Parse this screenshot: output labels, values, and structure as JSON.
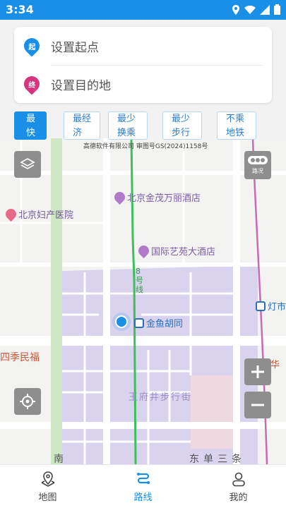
{
  "status_bar": {
    "time": "3:34"
  },
  "search": {
    "start_placeholder": "设置起点",
    "start_badge": "起",
    "end_placeholder": "设置目的地",
    "end_badge": "终"
  },
  "route_tabs": [
    {
      "label": "最快捷",
      "active": true
    },
    {
      "label": "最经济",
      "active": false
    },
    {
      "label": "最少换乘",
      "active": false
    },
    {
      "label": "最少步行",
      "active": false
    },
    {
      "label": "不乘地铁",
      "active": false
    }
  ],
  "map": {
    "copyright": "高德软件有限公司 审图号GS(2024)1158号",
    "traffic_label": "路况",
    "line_label": "8号线",
    "pois": [
      {
        "name": "北京金茂万丽酒店"
      },
      {
        "name": "北京妇产医院"
      },
      {
        "name": "国际艺苑大酒店"
      },
      {
        "name": "金鱼胡同"
      },
      {
        "name": "灯市"
      },
      {
        "name": "中华"
      }
    ],
    "area_labels": [
      "王府井步行街",
      "四季民福",
      "东单三条",
      "南"
    ]
  },
  "bottom_nav": [
    {
      "label": "地图",
      "icon": "map-pin-icon",
      "active": false
    },
    {
      "label": "路线",
      "icon": "route-icon",
      "active": true
    },
    {
      "label": "我的",
      "icon": "user-icon",
      "active": false
    }
  ],
  "colors": {
    "accent": "#1a8fe8",
    "metro_line": "#3fbf5a",
    "district": "#d9d3ee"
  }
}
